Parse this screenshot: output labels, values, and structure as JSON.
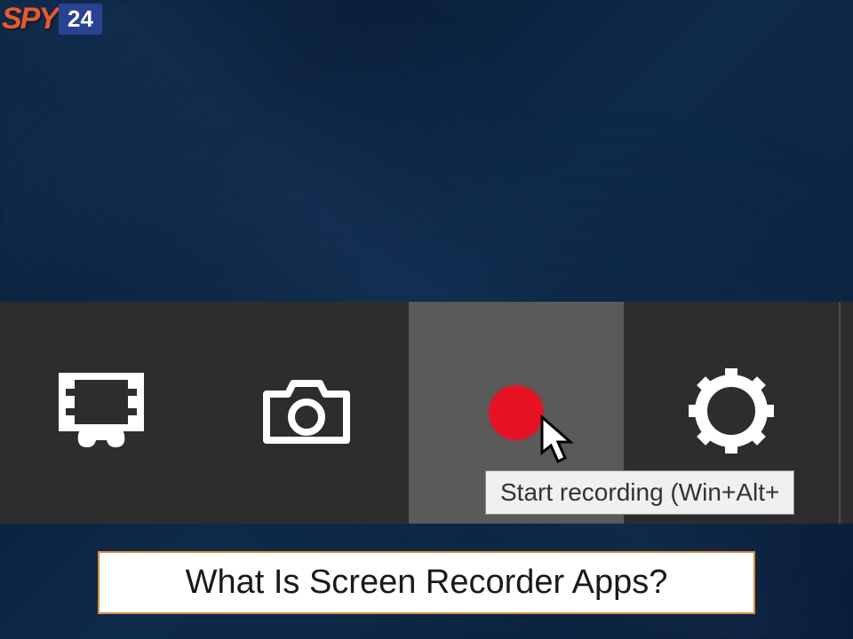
{
  "logo": {
    "brand_text": "SPY",
    "brand_number": "24"
  },
  "gamebar": {
    "buttons": {
      "record_clip": "Record that",
      "screenshot": "Screenshot",
      "start_recording": "Start recording",
      "settings": "Settings"
    }
  },
  "tooltip": {
    "text": "Start recording (Win+Alt+"
  },
  "caption": {
    "text": "What Is Screen Recorder Apps?"
  },
  "colors": {
    "record_red": "#e81123",
    "toolbar_bg": "#2d2d2d",
    "hover_bg": "#5a5a5a",
    "logo_orange": "#e85a2c",
    "logo_blue": "#2a4294",
    "caption_border": "#d88a3c"
  }
}
